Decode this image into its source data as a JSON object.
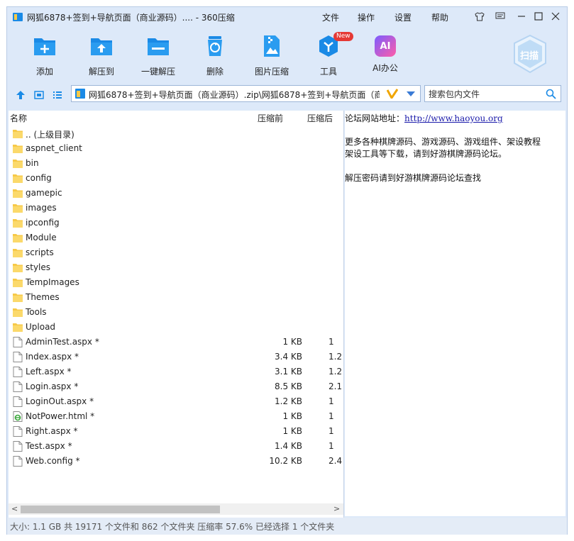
{
  "window": {
    "title": "网狐6878+签到+导航页面（商业源码）.... - 360压缩",
    "menus": [
      "文件",
      "操作",
      "设置",
      "帮助"
    ],
    "controls": [
      "shirt-icon",
      "feedback-icon",
      "minimize-icon",
      "maximize-icon",
      "close-icon"
    ]
  },
  "toolbar": {
    "items": [
      {
        "label": "添加",
        "icon": "add-icon"
      },
      {
        "label": "解压到",
        "icon": "extract-to-icon"
      },
      {
        "label": "一键解压",
        "icon": "one-click-extract-icon"
      },
      {
        "label": "删除",
        "icon": "delete-icon"
      },
      {
        "label": "图片压缩",
        "icon": "image-compress-icon"
      },
      {
        "label": "工具",
        "icon": "tools-icon",
        "badge": "New"
      },
      {
        "label": "AI办公",
        "icon": "ai-office-icon",
        "glyph": "AI"
      }
    ],
    "scan_label": "扫描"
  },
  "address": {
    "path": "网狐6878+签到+导航页面（商业源码）.zip\\网狐6878+签到+导航页面（商业",
    "search_placeholder": "搜索包内文件"
  },
  "file_list": {
    "columns": {
      "name": "名称",
      "size_before": "压缩前",
      "size_after": "压缩后"
    },
    "rows": [
      {
        "name": ".. (上级目录)",
        "type": "folder",
        "size": "",
        "comp": ""
      },
      {
        "name": "aspnet_client",
        "type": "folder",
        "size": "",
        "comp": ""
      },
      {
        "name": "bin",
        "type": "folder",
        "size": "",
        "comp": ""
      },
      {
        "name": "config",
        "type": "folder",
        "size": "",
        "comp": ""
      },
      {
        "name": "gamepic",
        "type": "folder",
        "size": "",
        "comp": ""
      },
      {
        "name": "images",
        "type": "folder",
        "size": "",
        "comp": ""
      },
      {
        "name": "ipconfig",
        "type": "folder",
        "size": "",
        "comp": ""
      },
      {
        "name": "Module",
        "type": "folder",
        "size": "",
        "comp": ""
      },
      {
        "name": "scripts",
        "type": "folder",
        "size": "",
        "comp": ""
      },
      {
        "name": "styles",
        "type": "folder",
        "size": "",
        "comp": ""
      },
      {
        "name": "TempImages",
        "type": "folder",
        "size": "",
        "comp": ""
      },
      {
        "name": "Themes",
        "type": "folder",
        "size": "",
        "comp": ""
      },
      {
        "name": "Tools",
        "type": "folder",
        "size": "",
        "comp": ""
      },
      {
        "name": "Upload",
        "type": "folder",
        "size": "",
        "comp": ""
      },
      {
        "name": "AdminTest.aspx *",
        "type": "file",
        "size": "1 KB",
        "comp": "1"
      },
      {
        "name": "Index.aspx *",
        "type": "file",
        "size": "3.4 KB",
        "comp": "1.2"
      },
      {
        "name": "Left.aspx *",
        "type": "file",
        "size": "3.1 KB",
        "comp": "1.2"
      },
      {
        "name": "Login.aspx *",
        "type": "file",
        "size": "8.5 KB",
        "comp": "2.1"
      },
      {
        "name": "LoginOut.aspx *",
        "type": "file",
        "size": "1.2 KB",
        "comp": "1"
      },
      {
        "name": "NotPower.html *",
        "type": "html",
        "size": "1 KB",
        "comp": "1"
      },
      {
        "name": "Right.aspx *",
        "type": "file",
        "size": "1 KB",
        "comp": "1"
      },
      {
        "name": "Test.aspx *",
        "type": "file",
        "size": "1.4 KB",
        "comp": "1"
      },
      {
        "name": "Web.config *",
        "type": "file",
        "size": "10.2 KB",
        "comp": "2.4"
      }
    ]
  },
  "info_panel": {
    "forum_label": "论坛网站地址：",
    "forum_url": "http://www.haoyou.org",
    "line2": "更多各种棋牌源码、游戏源码、游戏组件、架设教程",
    "line3": "架设工具等下载，请到好游棋牌源码论坛。",
    "line4": "解压密码请到好游棋牌源码论坛查找"
  },
  "status": {
    "text": "大小: 1.1 GB 共 19171 个文件和 862 个文件夹 压缩率 57.6% 已经选择 1 个文件夹"
  },
  "colors": {
    "accent": "#1a8ae6",
    "folder": "#f7c948",
    "window_bg": "#dde9f9",
    "new_badge": "#e53935"
  }
}
